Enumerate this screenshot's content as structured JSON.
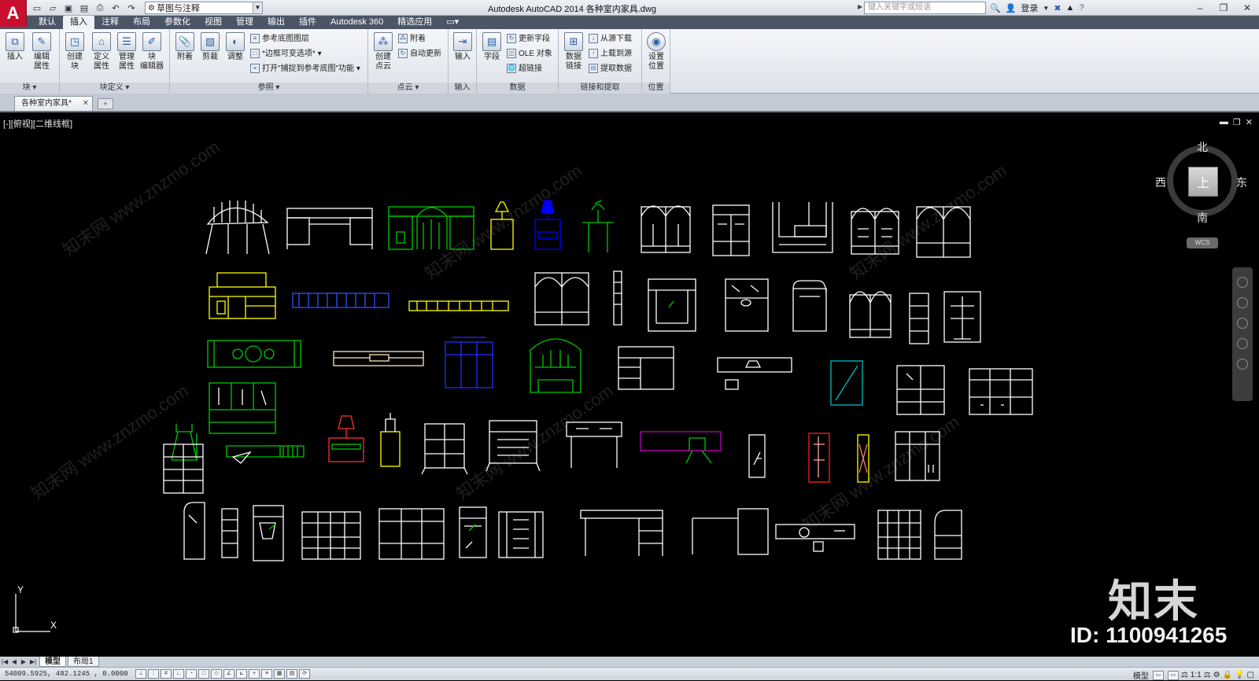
{
  "app": {
    "title": "Autodesk AutoCAD 2014    各种室内家具.dwg",
    "logo_letter": "A",
    "workspace": "草图与注释",
    "search_placeholder": "键入关键字或短语",
    "login_label": "登录"
  },
  "quick_access": {
    "icons": [
      "new-icon",
      "open-icon",
      "save-icon",
      "saveas-icon",
      "print-icon",
      "undo-icon",
      "redo-icon"
    ]
  },
  "ribbon_tabs": [
    {
      "label": "默认",
      "active": false
    },
    {
      "label": "插入",
      "active": true
    },
    {
      "label": "注释",
      "active": false
    },
    {
      "label": "布局",
      "active": false
    },
    {
      "label": "参数化",
      "active": false
    },
    {
      "label": "视图",
      "active": false
    },
    {
      "label": "管理",
      "active": false
    },
    {
      "label": "输出",
      "active": false
    },
    {
      "label": "插件",
      "active": false
    },
    {
      "label": "Autodesk 360",
      "active": false
    },
    {
      "label": "精选应用",
      "active": false
    }
  ],
  "panels": {
    "block": {
      "title": "块 ▾",
      "insert": "插入",
      "edit_attr_1": "编辑",
      "edit_attr_2": "属性"
    },
    "block_def": {
      "title": "块定义 ▾",
      "create_1": "创建",
      "create_2": "块",
      "define_1": "定义",
      "define_2": "属性",
      "manage_1": "管理",
      "manage_2": "属性",
      "editor_1": "块",
      "editor_2": "编辑器"
    },
    "reference": {
      "title": "参照 ▾",
      "attach": "附着",
      "clip": "剪裁",
      "adjust": "调整",
      "underlay_layers": "参考底图图层",
      "frames": "*边框可变选项*",
      "snap": "打开\"捕捉到参考底图\"功能"
    },
    "pointcloud": {
      "title": "点云 ▾",
      "create_1": "创建",
      "create_2": "点云",
      "attach": "附着",
      "auto_update": "自动更新"
    },
    "import": {
      "title": "输入",
      "import": "输入"
    },
    "data": {
      "title": "数据",
      "field": "字段",
      "update_fields": "更新字段",
      "ole": "OLE 对象",
      "hyperlink": "超链接"
    },
    "linking": {
      "title": "链接和提取",
      "data_link_1": "数据",
      "data_link_2": "链接",
      "download": "从源下载",
      "upload": "上载到源",
      "extract": "提取数据"
    },
    "location": {
      "title": "位置",
      "set_1": "设置",
      "set_2": "位置"
    }
  },
  "file_tab": {
    "label": "各种室内家具*",
    "close": "✕"
  },
  "viewport": {
    "label": "[-][俯视][二维线框]",
    "compass": {
      "north": "北",
      "south": "南",
      "east": "东",
      "west": "西",
      "face": "上"
    },
    "wcs": "WCS",
    "ucs_x": "X",
    "ucs_y": "Y"
  },
  "overlay": {
    "logo": "知末",
    "id_text": "ID: 1100941265",
    "watermark": "知末网 www.znzmo.com"
  },
  "layout_tabs": [
    {
      "label": "模型",
      "active": true
    },
    {
      "label": "布局1",
      "active": false
    }
  ],
  "status": {
    "coordinates": "54009.5925, 482.1245 , 0.0000",
    "model_label": "模型",
    "scale": "1:1"
  },
  "colors": {
    "canvas": "#000000",
    "white_lines": "#ffffff",
    "yellow": "#ffff00",
    "green": "#00c800",
    "blue": "#0000ff",
    "magenta": "#c000c0",
    "cyan": "#00c0c0",
    "red": "#ff0000"
  }
}
